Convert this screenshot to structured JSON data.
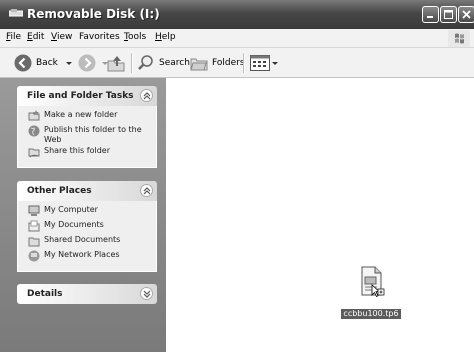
{
  "window": {
    "title": "Removable Disk (I:)"
  },
  "menu": {
    "items": [
      {
        "accel": "F",
        "rest": "ile"
      },
      {
        "accel": "E",
        "rest": "dit"
      },
      {
        "accel": "V",
        "rest": "iew"
      },
      {
        "accel": "",
        "rest": "Favorites"
      },
      {
        "accel": "T",
        "rest": "ools"
      },
      {
        "accel": "H",
        "rest": "elp"
      }
    ]
  },
  "toolbar": {
    "back_label": "Back",
    "search_label": "Search",
    "folders_label": "Folders"
  },
  "panels": {
    "file_tasks": {
      "title": "File and Folder Tasks",
      "items": [
        "Make a new folder",
        "Publish this folder to the Web",
        "Share this folder"
      ]
    },
    "other_places": {
      "title": "Other Places",
      "items": [
        "My Computer",
        "My Documents",
        "Shared Documents",
        "My Network Places"
      ]
    },
    "details": {
      "title": "Details"
    }
  },
  "content": {
    "files": [
      {
        "name": "ccbbu100.tp6",
        "icon": "document-icon"
      }
    ]
  }
}
